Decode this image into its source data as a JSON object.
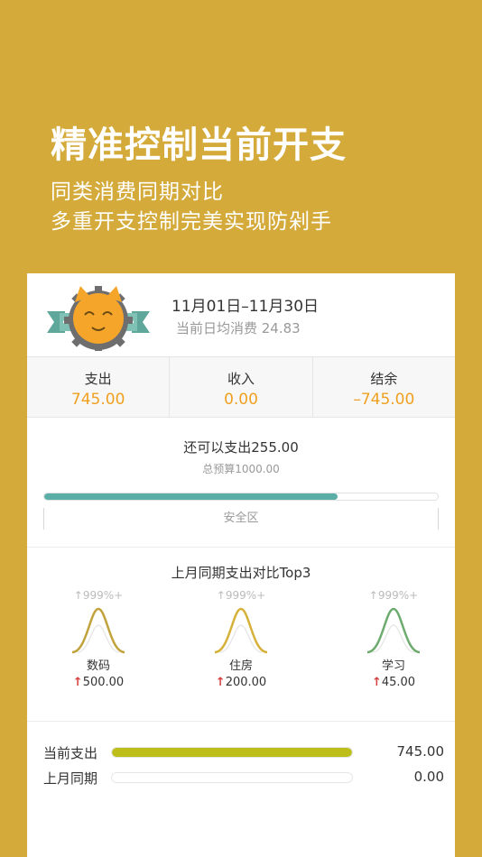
{
  "hero": {
    "title": "精准控制当前开支",
    "subtitle1": "同类消费同期对比",
    "subtitle2": "多重开支控制完美实现防剁手"
  },
  "summary": {
    "date_range": "11月01日–11月30日",
    "daily_avg_label": "当前日均消费 24.83"
  },
  "stats": [
    {
      "label": "支出",
      "value": "745.00"
    },
    {
      "label": "收入",
      "value": "0.00"
    },
    {
      "label": "结余",
      "value": "–745.00"
    }
  ],
  "budget": {
    "remaining": "还可以支出255.00",
    "total": "总预算1000.00",
    "used_fraction": 0.745,
    "zone": "安全区"
  },
  "compare": {
    "title": "上月同期支出对比Top3",
    "items": [
      {
        "pct": "999%+",
        "name": "数码",
        "amount": "500.00",
        "color": "#C1A23C"
      },
      {
        "pct": "999%+",
        "name": "住房",
        "amount": "200.00",
        "color": "#D6B13A"
      },
      {
        "pct": "999%+",
        "name": "学习",
        "amount": "45.00",
        "color": "#6EAB6E"
      }
    ]
  },
  "totals": {
    "current": {
      "label": "当前支出",
      "value": "745.00",
      "fraction": 1.0
    },
    "last": {
      "label": "上月同期",
      "value": "0.00",
      "fraction": 0.0
    }
  },
  "colors": {
    "background": "#D4AA3A",
    "accent": "#F0A020",
    "progress": "#5BAEA5",
    "total_bar": "#BDBE1A",
    "arrow": "#D64040"
  }
}
